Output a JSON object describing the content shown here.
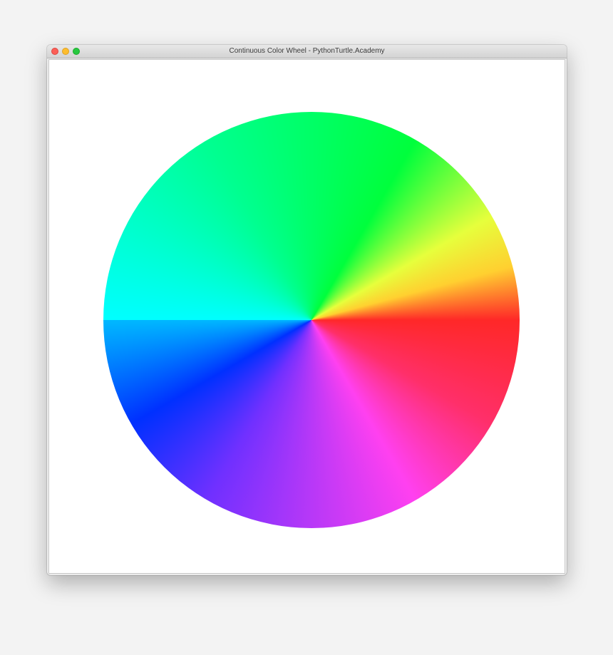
{
  "window": {
    "title": "Continuous Color Wheel - PythonTurtle.Academy"
  },
  "icons": {
    "close": "close-window-button",
    "minimize": "minimize-window-button",
    "maximize": "maximize-window-button"
  },
  "colors": {
    "close": "#fc5f57",
    "minimize": "#fdbd2e",
    "maximize": "#27c840",
    "canvas_background": "#ffffff",
    "wheel_red": "#ff2828",
    "wheel_magenta": "#ff40f0",
    "wheel_blue": "#0030ff",
    "wheel_cyan": "#00ffff",
    "wheel_green": "#00ff3c",
    "wheel_yellow": "#ffff3c"
  }
}
